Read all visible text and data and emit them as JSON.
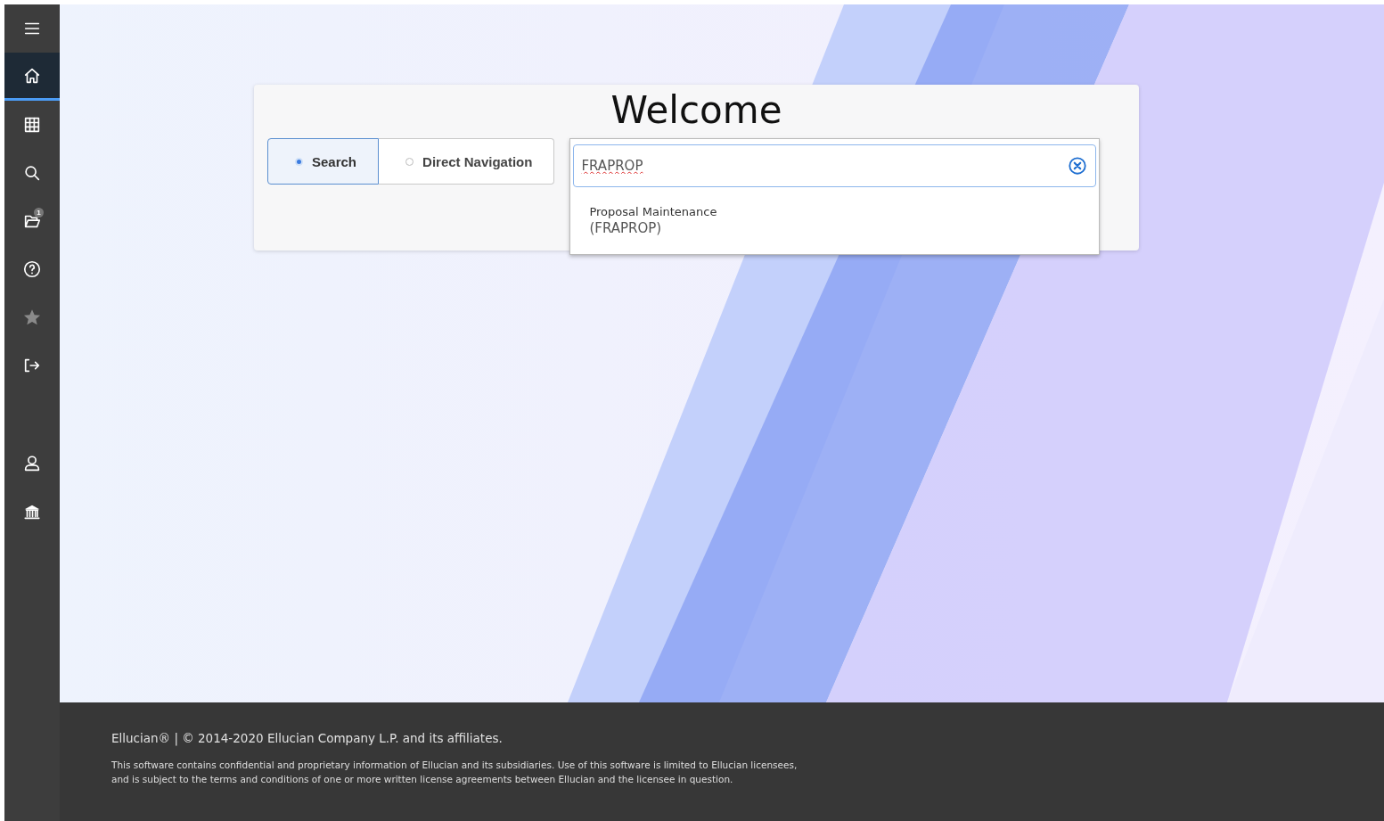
{
  "sidebar": {
    "items": [
      {
        "kind": "menu",
        "selected": false,
        "disabled": false
      },
      {
        "kind": "home",
        "selected": true,
        "disabled": false
      },
      {
        "kind": "grid",
        "selected": false,
        "disabled": false
      },
      {
        "kind": "search",
        "selected": false,
        "disabled": false
      },
      {
        "kind": "folder",
        "selected": false,
        "disabled": false,
        "badge": "1"
      },
      {
        "kind": "help",
        "selected": false,
        "disabled": false
      },
      {
        "kind": "star",
        "selected": false,
        "disabled": true
      },
      {
        "kind": "signout",
        "selected": false,
        "disabled": false
      },
      {
        "kind": "spacer"
      },
      {
        "kind": "user",
        "selected": false,
        "disabled": false
      },
      {
        "kind": "bank",
        "selected": false,
        "disabled": false
      }
    ]
  },
  "welcome": {
    "title": "Welcome",
    "modes": [
      {
        "label": "Search",
        "selected": true
      },
      {
        "label": "Direct Navigation",
        "selected": false
      }
    ],
    "search": {
      "value": "FRAPROP",
      "results": [
        {
          "title": "Proposal Maintenance",
          "code": "(FRAPROP)"
        }
      ]
    }
  },
  "footer": {
    "copyright": "Ellucian® | © 2014-2020 Ellucian Company L.P. and its affiliates.",
    "notice": [
      "This software contains confidential and proprietary information of Ellucian and its subsidiaries. Use of this software is limited to Ellucian licensees,",
      "and is subject to the terms and conditions of one or more written license agreements between Ellucian and the licensee in question."
    ]
  }
}
